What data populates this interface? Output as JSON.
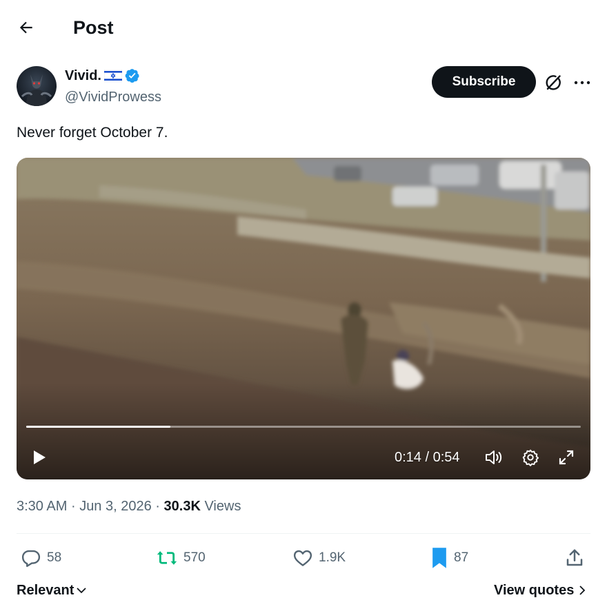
{
  "header": {
    "title": "Post",
    "back_icon": "arrow-left-icon"
  },
  "author": {
    "display_name": "Vivid.",
    "flag": "israel-flag-icon",
    "verified": true,
    "handle": "@VividProwess",
    "avatar": "avatar"
  },
  "actions_top": {
    "subscribe_label": "Subscribe",
    "grok_icon": "grok-icon",
    "more_icon": "more-icon"
  },
  "post": {
    "text": "Never forget October 7."
  },
  "video": {
    "time_readout": "0:14 / 0:54",
    "progress": 0.26,
    "controls": [
      "play-icon",
      "volume-icon",
      "settings-icon",
      "fullscreen-icon"
    ]
  },
  "meta": {
    "time": "3:30 AM",
    "date": "Jun 3, 2026",
    "views_count": "30.3K",
    "views_label": "Views",
    "separator": "·"
  },
  "engagement": {
    "replies": "58",
    "reposts": "570",
    "likes": "1.9K",
    "bookmarks": "87"
  },
  "footer": {
    "sort_label": "Relevant",
    "view_quotes_label": "View quotes"
  },
  "colors": {
    "accent": "#1d9bf0",
    "repost": "#00ba7c",
    "text": "#0f1419",
    "muted": "#536471",
    "button_dark": "#0f1419"
  }
}
